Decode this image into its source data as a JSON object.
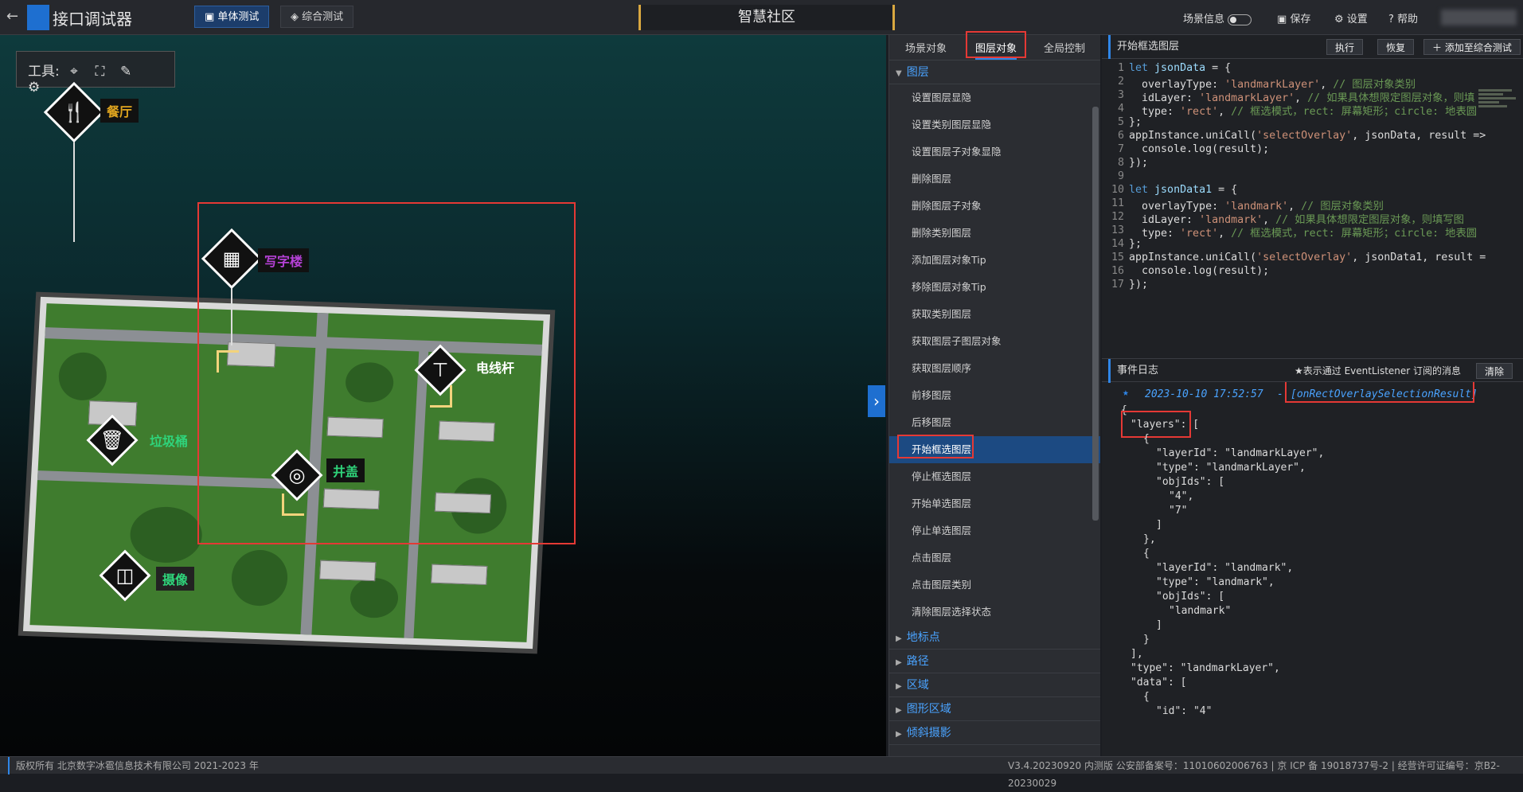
{
  "topbar": {
    "back_icon": "arrow-left-icon",
    "app_title": "接口调试器",
    "tab_unit": "单体测试",
    "tab_integrated": "综合测试",
    "scene_name": "智慧社区",
    "scene_info": "场景信息",
    "save": "保存",
    "settings": "设置",
    "help": "帮助"
  },
  "toolbar": {
    "label": "工具:",
    "icons": [
      "locate-icon",
      "frame-icon",
      "pen-icon",
      "gears-icon"
    ]
  },
  "markers": {
    "restaurant": "餐厅",
    "office": "写字楼",
    "pole": "电线杆",
    "trash": "垃圾桶",
    "manhole": "井盖",
    "camera": "摄像"
  },
  "left_panel": {
    "tabs": [
      "场景对象",
      "图层对象",
      "全局控制"
    ],
    "active_tab": "图层对象",
    "group_layer": "图层",
    "items": [
      "设置图层显隐",
      "设置类别图层显隐",
      "设置图层子对象显隐",
      "删除图层",
      "删除图层子对象",
      "删除类别图层",
      "添加图层对象Tip",
      "移除图层对象Tip",
      "获取类别图层",
      "获取图层子图层对象",
      "获取图层顺序",
      "前移图层",
      "后移图层",
      "开始框选图层",
      "停止框选图层",
      "开始单选图层",
      "停止单选图层",
      "点击图层",
      "点击图层类别",
      "清除图层选择状态"
    ],
    "active_item": "开始框选图层",
    "groups": [
      "地标点",
      "路径",
      "区域",
      "图形区域",
      "倾斜摄影"
    ]
  },
  "code_panel": {
    "title": "开始框选图层",
    "run": "执行",
    "reset": "恢复",
    "add": "添加至综合测试"
  },
  "log_panel": {
    "title": "事件日志",
    "hint": "★表示通过 EventListener 订阅的消息",
    "clear": "清除",
    "timestamp": "2023-10-10 17:52:57",
    "event": "[onRectOverlaySelectionResult]"
  },
  "footer": {
    "copyright": "版权所有 北京数字冰雹信息技术有限公司 2021-2023 年",
    "version": "V3.4.20230920 内测版 公安部备案号：11010602006763 | 京 ICP 备 19018737号-2 | 经营许可证编号：京B2-20230029"
  }
}
